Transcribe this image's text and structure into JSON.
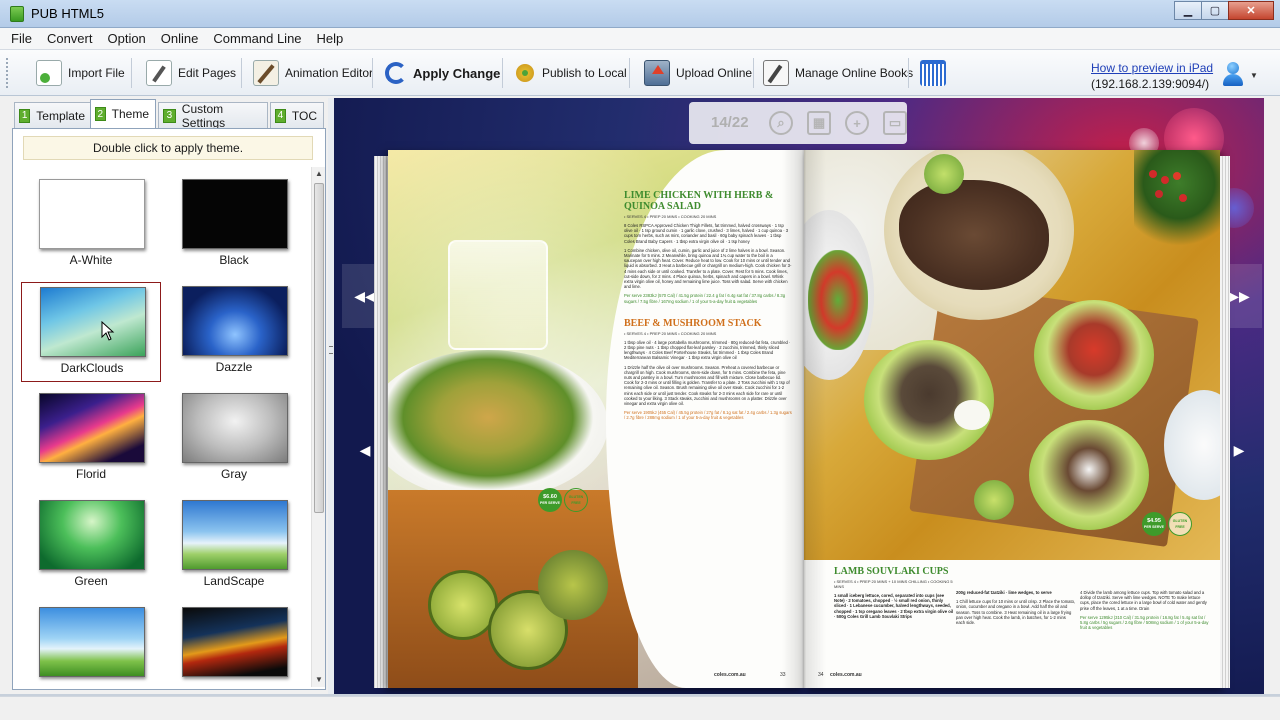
{
  "window": {
    "title": "PUB HTML5"
  },
  "menu": [
    "File",
    "Convert",
    "Option",
    "Online",
    "Command Line",
    "Help"
  ],
  "toolbar": {
    "import_file": "Import File",
    "edit_pages": "Edit Pages",
    "animation_editor": "Animation Editor",
    "apply_change": "Apply Change",
    "publish_local": "Publish to Local",
    "upload_online": "Upload Online",
    "manage_online_books": "Manage Online Books",
    "preview_link": "How to preview in iPad",
    "preview_ip": "(192.168.2.139:9094/)"
  },
  "tabs": [
    {
      "num": "1",
      "label": "Template"
    },
    {
      "num": "2",
      "label": "Theme"
    },
    {
      "num": "3",
      "label": "Custom Settings"
    },
    {
      "num": "4",
      "label": "TOC"
    }
  ],
  "theme_panel": {
    "hint": "Double click to apply theme.",
    "themes": [
      "A-White",
      "Black",
      "DarkClouds",
      "Dazzle",
      "Florid",
      "Gray",
      "Green",
      "LandScape",
      "",
      ""
    ],
    "selected": "DarkClouds"
  },
  "book": {
    "page_indicator": "14/22",
    "left_page": {
      "title1": "LIME CHICKEN WITH HERB & QUINOA SALAD",
      "meta1": "• SERVES 4 • PREP 20 MINS • COOKING 20 MINS",
      "ingredients1": "8 Coles RSPCA Approved Chicken Thigh Fillets, fat trimmed, halved crossways · 1 tsp olive oil · 1 tsp ground cumin · 1 garlic clove, crushed · 3 limes, halved · 1 cup quinoa · 3 cups torn herbs, such as mint, coriander and basil · 60g baby spinach leaves · 1 tbsp Coles Brand Baby Capers · 1 tbsp extra virgin olive oil · 1 tsp honey",
      "method1": "1 Combine chicken, olive oil, cumin, garlic and juice of 2 lime halves in a bowl. Season. Marinate for 5 mins. 2 Meanwhile, bring quinoa and 1¾ cup water to the boil in a saucepan over high heat. Cover. Reduce heat to low. Cook for 10 mins or until tender and liquid is absorbed. 3 Heat a barbecue grill or chargrill on medium-high. Cook chicken for 3-4 mins each side or until cooked. Transfer to a plate. Cover. Rest for 5 mins. Cook limes, cut-side down, for 2 mins. 4 Place quinoa, herbs, spinach and capers in a bowl. Whisk extra virgin olive oil, honey and remaining lime juice. Toss with salad. Serve with chicken and lime.",
      "nutrition1": "Per serve 2383kJ (570 Cal) / 41.5g protein / 22.4 g fat / 6.4g sat fat / 37.8g carbs / 8.3g sugars / 7.5g fibre / 167mg sodium / 1 of your 5-a-day fruit & vegetables",
      "title2": "BEEF & MUSHROOM STACK",
      "meta2": "• SERVES 4 • PREP 20 MINS • COOKING 20 MINS",
      "ingredients2": "1 tbsp olive oil · 4 large portabella mushrooms, trimmed · 80g reduced-fat feta, crumbled · 2 tbsp pine nuts · 1 tbsp chopped flat-leaf parsley · 2 zucchini, trimmed, thinly sliced lengthways · 4 Coles Beef Porterhouse Steaks, fat trimmed · 1 tbsp Coles Brand Mediterranean Balsamic Vinegar · 1 tbsp extra virgin olive oil",
      "method2": "1 Drizzle half the olive oil over mushrooms. Season. Preheat a covered barbecue or chargrill on high. Cook mushrooms, stem-side down, for 5 mins. Combine the feta, pine nuts and parsley in a bowl. Turn mushrooms and fill with mixture. Close barbecue lid. Cook for 2-3 mins or until filling is golden. Transfer to a plate. 2 Toss zucchini with 1 tsp of remaining olive oil. Season. Brush remaining olive oil over steak. Cook zucchini for 1-2 mins each side or until just tender. Cook steaks for 2-3 mins each side for rare or until cooked to your liking. 3 Stack steaks, zucchini and mushrooms on a platter. Drizzle over vinegar and extra virgin olive oil.",
      "nutrition2": "Per serve 1905kJ (455 Cal) / 45.5g protein / 27g fat / 8.1g sat fat / 2.4g carbs / 1.3g sugars / 2.7g fibre / 288mg sodium / 1 of your 5-a-day fruit & vegetables",
      "price": "$6.60",
      "price_sub": "PER SERVE",
      "badge": "GLUTEN FREE",
      "footer_site": "coles.com.au",
      "page_no": "33"
    },
    "right_page": {
      "title": "LAMB SOUVLAKI CUPS",
      "meta": "• SERVES 4 • PREP 20 MINS + 10 MINS CHILLING • COOKING 5 MINS",
      "ingredients_a": "1 small iceberg lettuce, cored, separated into cups (see Note) · 2 tomatoes, chopped · ½ small red onion, thinly sliced · 1 Lebanese cucumber, halved lengthways, seeded, chopped · 1 tsp oregano leaves · 2 tbsp extra virgin olive oil · 500g Coles Grill Lamb Souvlaki Strips",
      "ingredients_b": "200g reduced-fat tzatziki · lime wedges, to serve",
      "method_a": "1 Chill lettuce cups for 10 mins or until crisp. 2 Place the tomato, onion, cucumber and oregano in a bowl. Add half the oil and season. Toss to combine. 3 Heat remaining oil in a large frying pan over high heat. Cook the lamb, in batches, for 1-2 mins each side.",
      "method_b": "4 Divide the lamb among lettuce cups. Top with tomato salad and a dollop of tzatziki. Serve with lime wedges. NOTE To make lettuce cups, place the cored lettuce in a large bowl of cold water and gently prise off the leaves, 1 at a time. Drain",
      "nutrition": "Per serve 1295kJ (310 Cal) / 31.5g protein / 16.8g fat / 5.4g sat fat / 5.8g carbs / 5g sugars / 2.6g fibre / 508mg sodium / 1 of your 5-a-day fruit & vegetables",
      "price": "$4.95",
      "price_sub": "PER SERVE",
      "badge": "GLUTEN FREE",
      "footer_site": "coles.com.au",
      "page_no": "34"
    }
  }
}
